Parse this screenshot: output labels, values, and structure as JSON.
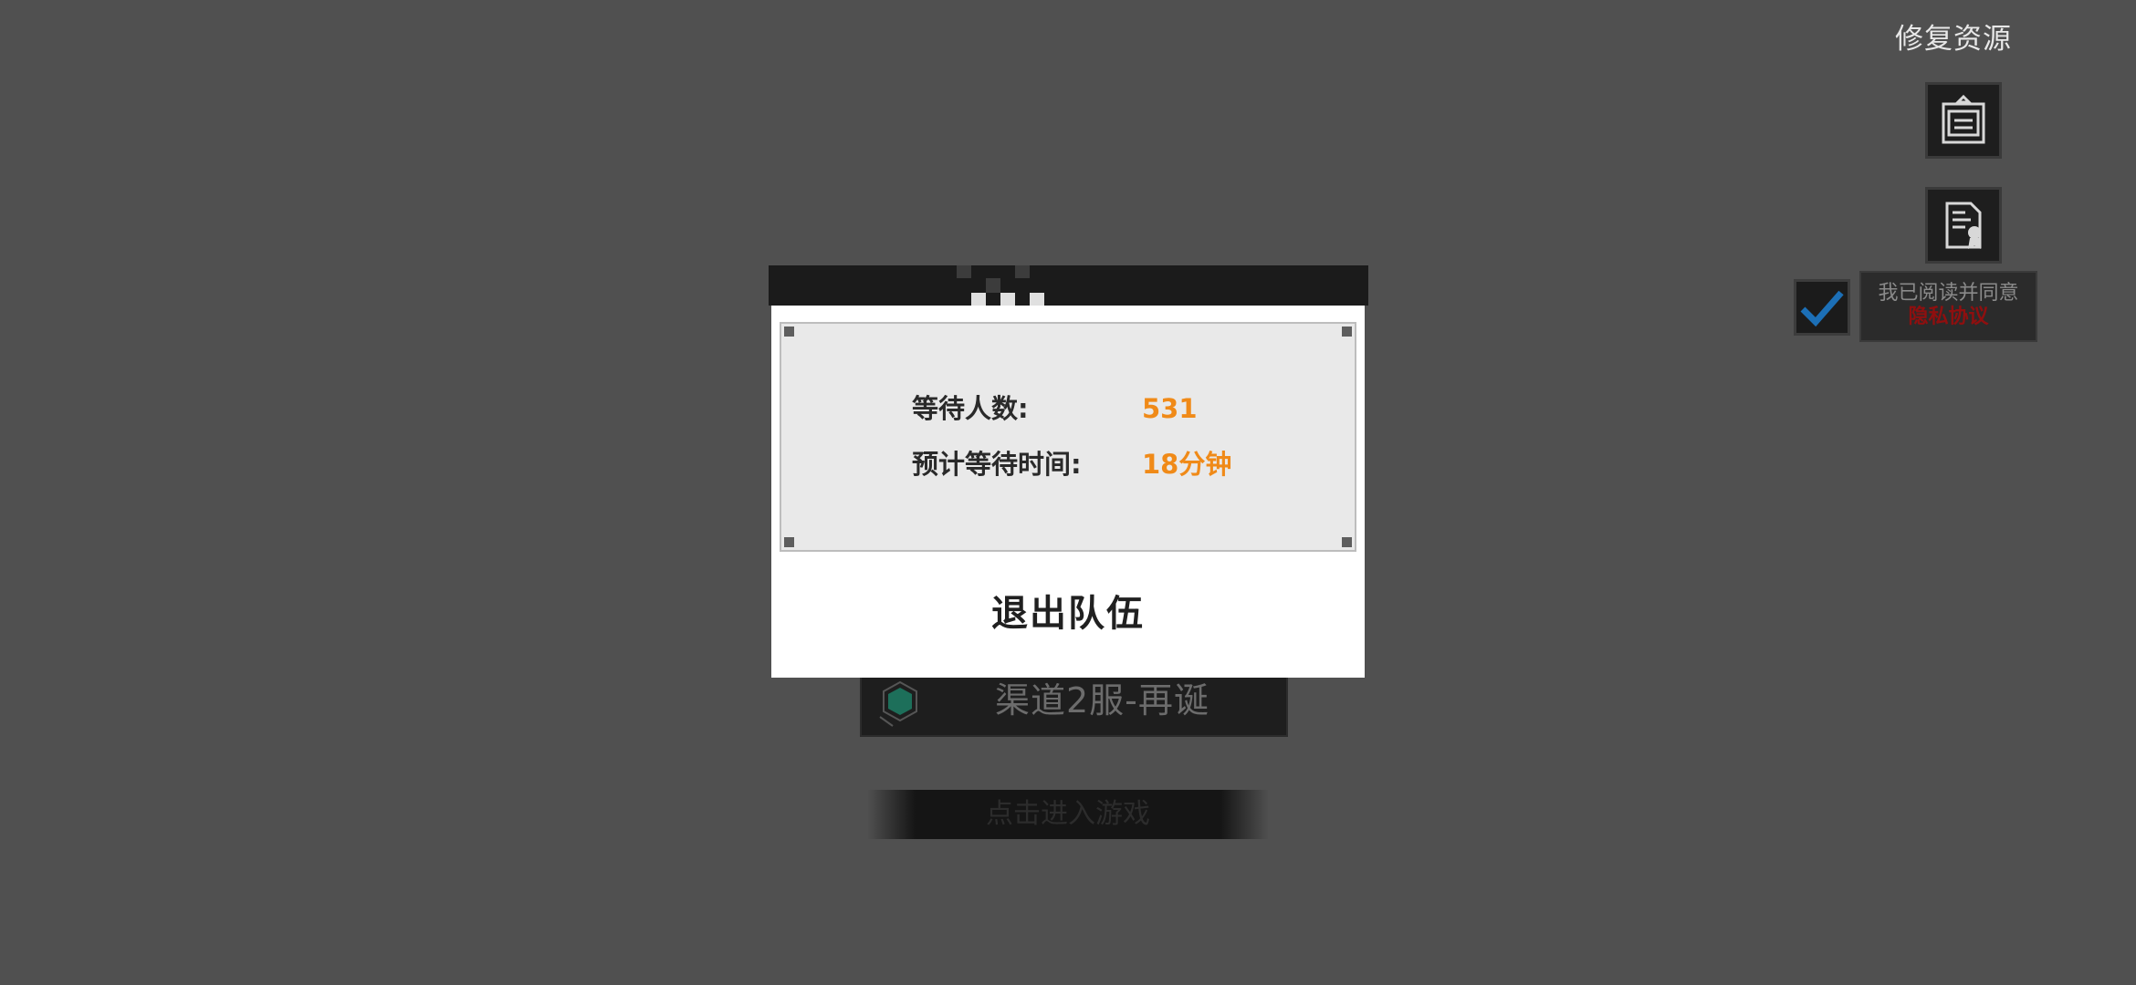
{
  "repair": {
    "label": "修复资源"
  },
  "icons": {
    "notice": "notice-board-icon",
    "certificate": "certificate-icon",
    "check": "checkmark-icon",
    "server": "hexagon-server-icon"
  },
  "agreement": {
    "text": "我已阅读并同意",
    "link": "隐私协议",
    "checked": true
  },
  "server": {
    "name": "渠道2服-再诞"
  },
  "enter": {
    "label": "点击进入游戏"
  },
  "queue": {
    "waiting_label": "等待人数:",
    "waiting_value": "531",
    "time_label": "预计等待时间:",
    "time_value": "18分钟",
    "exit_label": "退出队伍"
  },
  "colors": {
    "overlay": "#505050",
    "accent_value": "#f08a18",
    "link_red": "#8f0f0f",
    "check_blue": "#1c6fb6"
  }
}
